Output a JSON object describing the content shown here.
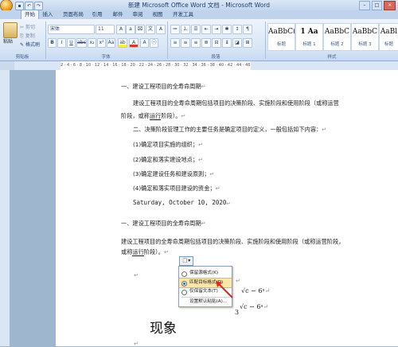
{
  "window": {
    "title": "新建 Microsoft Office Word 文档 - Microsoft Word"
  },
  "tabs": [
    "开始",
    "插入",
    "页面布局",
    "引用",
    "邮件",
    "审阅",
    "视图",
    "开发工具"
  ],
  "ribbon": {
    "clipboard": {
      "paste": "粘贴",
      "cut": "剪切",
      "copy": "复制",
      "format_painter": "格式刷",
      "label": "剪贴板"
    },
    "font": {
      "name": "宋体",
      "size": "11",
      "label": "字体"
    },
    "paragraph": {
      "label": "段落"
    },
    "styles": {
      "label": "样式",
      "items": [
        {
          "preview": "AaBbC(",
          "name": "标题"
        },
        {
          "preview": "1 Aa",
          "name": "标题 1"
        },
        {
          "preview": "AaBbC",
          "name": "标题 2"
        },
        {
          "preview": "AaBbC",
          "name": "标题 3"
        },
        {
          "preview": "AaBl",
          "name": "标题"
        }
      ]
    }
  },
  "ruler": {
    "ticks": "2 · 4 · 6 · 8 · 10 · 12 · 14 · 16 · 18 · 20 · 22 · 24 · 26 · 28 · 30 · 32 · 34 · 36 · 38 · 40 · 42 · 44 · 46"
  },
  "document": {
    "p1": "一、建设工程项目的全寿命周期",
    "p2a": "建设工程项目的全寿命周期包括项目的决策阶段、实施阶段和使用阶段（或称运营",
    "p2b_pre": "阶段，或称",
    "p2b_u": "运行",
    "p2b_post": "阶段）。",
    "p3": "二、决策阶段管理工作的主要任务是确定项目的定义，一般包括如下内容：",
    "l1": "(1)确定项目实施的组织；",
    "l2": "(2)确定和落实建设地点；",
    "l3": "(3)确定建设任务和建设原则；",
    "l4": "(4)确定和落实项目建设的资金；",
    "date": "Saturday, October 10, 2020",
    "p4": "一、建设工程项目的全寿命周期",
    "p5a": "建设工程项目的全寿命周期包括项目的决策阶段、实施阶段和使用阶段（或称运营阶段，",
    "p5b_pre": "或称",
    "p5b_u": "运行",
    "p5b_post": "阶段）。",
    "formula1": "√c − 6ᵃ",
    "formula2": "√c − 6ᵃ",
    "formula_den": "3",
    "big_text": "现象"
  },
  "paste_menu": {
    "items": [
      {
        "label": "保留源格式(K)"
      },
      {
        "label": "匹配目标格式(D)"
      },
      {
        "label": "仅保留文本(T)"
      },
      {
        "label": "设置默认粘贴(A)..."
      }
    ],
    "selected_index": 1
  }
}
